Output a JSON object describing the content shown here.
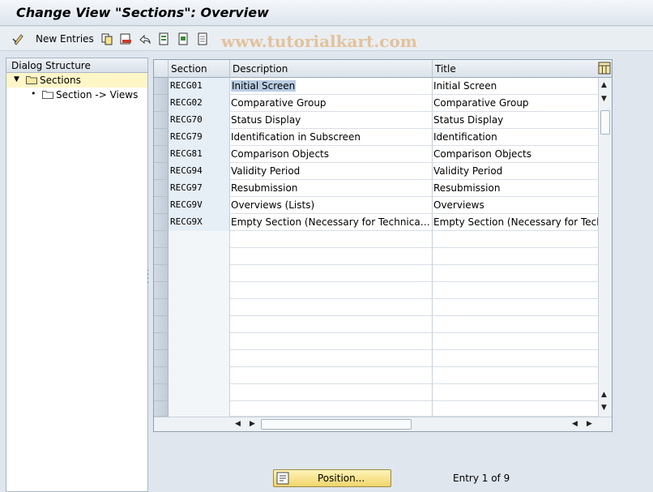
{
  "window": {
    "title": "Change View \"Sections\": Overview"
  },
  "toolbar": {
    "new_entries_label": "New Entries",
    "watermark": "www.tutorialkart.com"
  },
  "dialog_structure": {
    "header": "Dialog Structure",
    "items": [
      {
        "label": "Sections",
        "selected": true
      },
      {
        "label": "Section -> Views",
        "selected": false
      }
    ]
  },
  "table": {
    "columns": [
      "Section",
      "Description",
      "Title"
    ],
    "rows": [
      {
        "section": "RECG01",
        "description": "Initial Screen",
        "title": "Initial Screen"
      },
      {
        "section": "RECG02",
        "description": "Comparative Group",
        "title": "Comparative Group"
      },
      {
        "section": "RECG70",
        "description": "Status Display",
        "title": "Status Display"
      },
      {
        "section": "RECG79",
        "description": "Identification in Subscreen",
        "title": "Identification"
      },
      {
        "section": "RECG81",
        "description": "Comparison Objects",
        "title": "Comparison Objects"
      },
      {
        "section": "RECG94",
        "description": "Validity Period",
        "title": "Validity Period"
      },
      {
        "section": "RECG97",
        "description": "Resubmission",
        "title": "Resubmission"
      },
      {
        "section": "RECG9V",
        "description": "Overviews (Lists)",
        "title": "Overviews"
      },
      {
        "section": "RECG9X",
        "description": "Empty Section (Necessary for Technical Rea…",
        "title": "Empty Section (Necessary for Techn"
      }
    ]
  },
  "footer": {
    "position_label": "Position...",
    "entry_text": "Entry 1 of 9"
  }
}
